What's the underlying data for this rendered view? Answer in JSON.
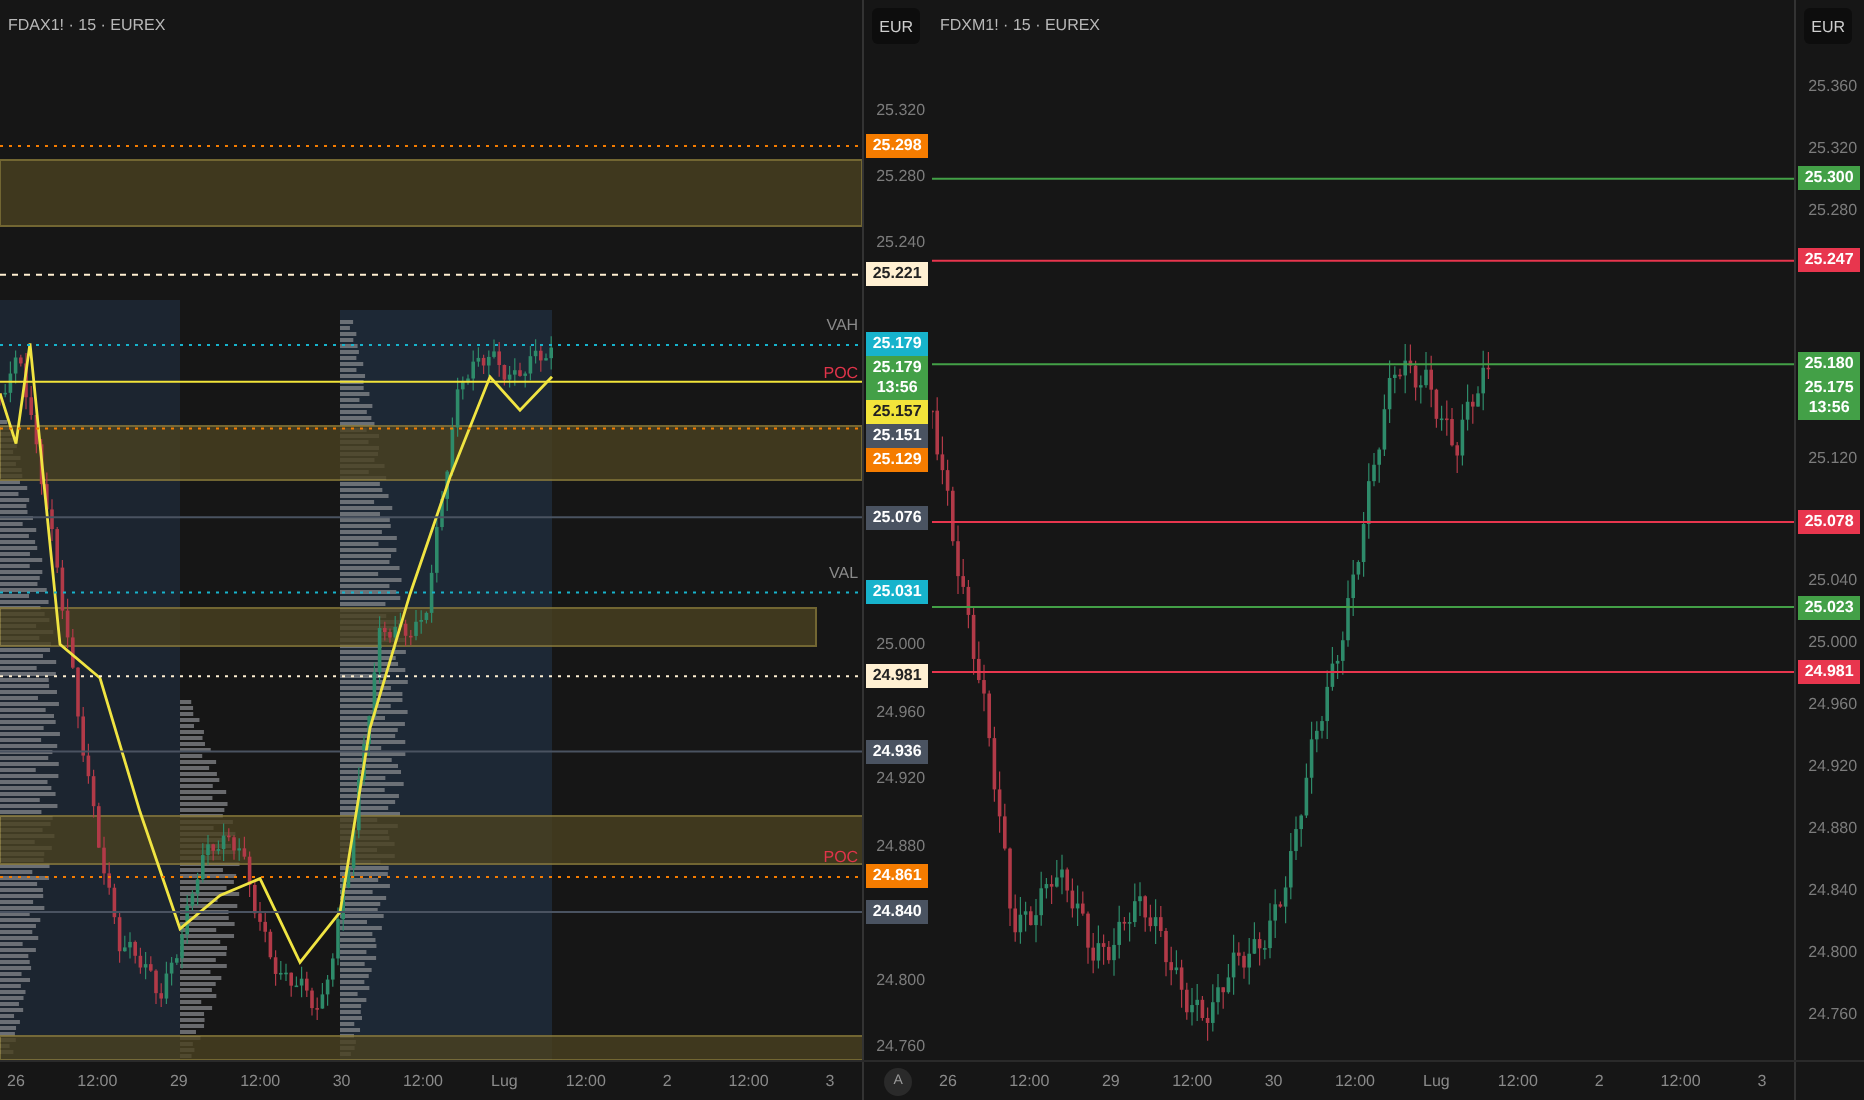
{
  "panels": [
    {
      "title": "FDAX1! · 15 · EUREX",
      "currency": "EUR",
      "kind": "profile",
      "ticks": [
        "25.320",
        "25.280",
        "25.240",
        "25.000",
        "24.960",
        "24.920",
        "24.880",
        "24.800",
        "24.760"
      ],
      "labels": [
        {
          "price": "25.298",
          "color": "#f57c00",
          "kind": "dotted"
        },
        {
          "price": "25.221",
          "color": "#fff0d2",
          "kind": "dashed"
        },
        {
          "price": "25.179",
          "color": "#17b3cc",
          "kind": "dotted",
          "tag": {
            "text": "VAH",
            "color": "#8a8a8a"
          }
        },
        {
          "price": "25.179",
          "color": "#43a047",
          "kind": "none",
          "countdown": "13:56"
        },
        {
          "price": "25.157",
          "color": "#f2e43a",
          "kind": "solid"
        },
        {
          "price": "25.151",
          "color": "#4a5361",
          "kind": "none",
          "tag": {
            "text": "POC",
            "color": "#e0344a"
          }
        },
        {
          "price": "25.129",
          "color": "#f57c00",
          "kind": "dotted"
        },
        {
          "price": "25.076",
          "color": "#4a5361",
          "kind": "solid"
        },
        {
          "price": "25.031",
          "color": "#17b3cc",
          "kind": "dotted",
          "tag": {
            "text": "VAL",
            "color": "#8a8a8a"
          }
        },
        {
          "price": "24.981",
          "color": "#fff0d2",
          "kind": "dotted"
        },
        {
          "price": "24.936",
          "color": "#4a5361",
          "kind": "solid"
        },
        {
          "price": "24.861",
          "color": "#f57c00",
          "kind": "dotted",
          "tag": {
            "text": "POC",
            "color": "#e0344a"
          }
        },
        {
          "price": "24.840",
          "color": "#4a5361",
          "kind": "solid"
        }
      ],
      "times": [
        "26",
        "12:00",
        "29",
        "12:00",
        "30",
        "12:00",
        "Lug",
        "12:00",
        "2",
        "12:00",
        "3"
      ],
      "corner": "A"
    },
    {
      "title": "FDXM1! · 15 · EUREX",
      "currency": "EUR",
      "kind": "plain",
      "ticks": [
        "25.360",
        "25.320",
        "25.280",
        "25.120",
        "25.040",
        "25.000",
        "24.960",
        "24.920",
        "24.880",
        "24.840",
        "24.800",
        "24.760"
      ],
      "labels": [
        {
          "price": "25.300",
          "color": "#43a047",
          "kind": "solid"
        },
        {
          "price": "25.247",
          "color": "#e8364e",
          "kind": "solid"
        },
        {
          "price": "25.180",
          "color": "#43a047",
          "kind": "solid"
        },
        {
          "price": "25.175",
          "color": "#43a047",
          "kind": "none",
          "countdown": "13:56"
        },
        {
          "price": "25.078",
          "color": "#e8364e",
          "kind": "solid"
        },
        {
          "price": "25.023",
          "color": "#43a047",
          "kind": "solid"
        },
        {
          "price": "24.981",
          "color": "#e8364e",
          "kind": "solid"
        }
      ],
      "times": [
        "26",
        "12:00",
        "29",
        "12:00",
        "30",
        "12:00",
        "Lug",
        "12:00",
        "2",
        "12:00",
        "3"
      ]
    }
  ]
}
